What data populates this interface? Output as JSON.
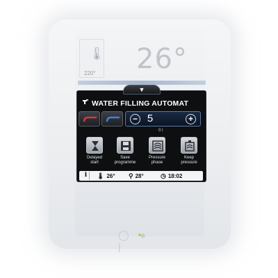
{
  "upper_screen": {
    "small_temperature": "220°",
    "large_temperature": "26°"
  },
  "panel": {
    "collapse_arrow": "▼",
    "title": "WATER FILLING AUTOMAT",
    "title_icon": "tap-icon",
    "stepper": {
      "minus_label": "−",
      "value": "5",
      "plus_label": "+"
    },
    "unit": "0 l",
    "functions": [
      {
        "label_line1": "Delayed",
        "label_line2": "start",
        "icon": "hourglass-icon"
      },
      {
        "label_line1": "Save",
        "label_line2": "programme",
        "icon": "save-icon"
      },
      {
        "label_line1": "Pressure",
        "label_line2": "phase",
        "icon": "pressure-icon"
      },
      {
        "label_line1": "Keep",
        "label_line2": "pressure",
        "icon": "keep-pressure-icon"
      }
    ],
    "status_bar": {
      "info": "i",
      "temp1": "26°",
      "temp2": "28°",
      "time": "18:02"
    }
  },
  "hardware": {
    "buttons": "◯ ●  |"
  },
  "colors": {
    "panel_bg": "#0e0f11",
    "stepper_border": "#5d7aa6",
    "accent_red": "#d63a3a",
    "accent_blue": "#4a7fd4"
  }
}
